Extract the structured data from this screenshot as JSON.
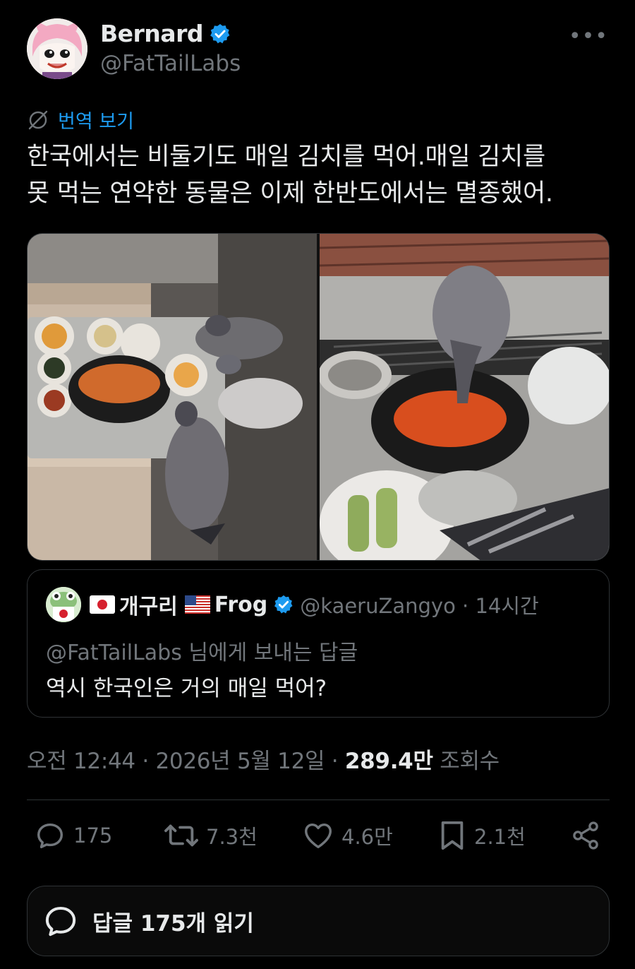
{
  "author": {
    "display_name": "Bernard",
    "handle": "@FatTailLabs",
    "verified_icon": "verified-badge-icon",
    "more_label": "•••"
  },
  "translate": {
    "label": "번역 보기",
    "icon": "globe-slash-icon"
  },
  "tweet": {
    "line1": "한국에서는 비둘기도 매일 김치를 먹어.매일 김치를",
    "line2": "못 먹는 연약한 동물은 이제 한반도에서는 멸종했어."
  },
  "media": {
    "images": [
      {
        "name": "pigeons-at-banchan-tray-photo"
      },
      {
        "name": "pigeon-eating-stew-photo"
      }
    ]
  },
  "quote": {
    "display_name": "개구리",
    "display_name_suffix": "Frog",
    "flags": [
      "japan-flag",
      "usa-flag"
    ],
    "handle_time": "@kaeruZangyo · 14시간",
    "reply_to": "@FatTailLabs 님에게 보내는 답글",
    "text": "역시 한국인은 거의 매일 먹어?"
  },
  "meta": {
    "timestamp": "오전 12:44 · 2026년 5월 12일 · ",
    "views_count": "289.4만",
    "views_label": " 조회수"
  },
  "actions": {
    "replies": "175",
    "reposts": "7.3천",
    "likes": "4.6만",
    "bookmarks": "2.1천"
  },
  "read_replies": {
    "label": "답글 175개 읽기"
  },
  "colors": {
    "background": "#000000",
    "text": "#e7e9ea",
    "secondary": "#71767b",
    "accent": "#1d9bf0",
    "border": "#2f3336"
  }
}
